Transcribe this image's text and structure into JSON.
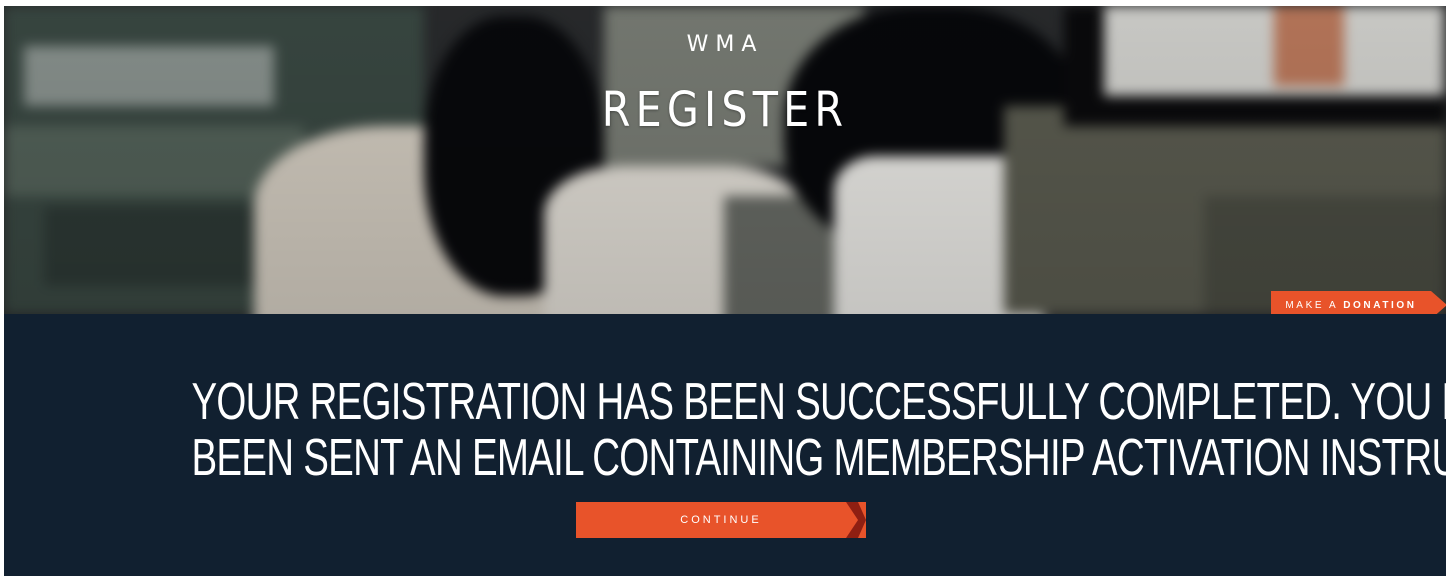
{
  "hero": {
    "brand": "WMA",
    "title": "REGISTER"
  },
  "donate": {
    "prefix": "MAKE A",
    "strong": "DONATION"
  },
  "message": {
    "line1": "Your registration has been successfully completed. You have just",
    "line2": "been sent an email containing membership activation instructions."
  },
  "actions": {
    "continue_label": "CONTINUE"
  },
  "colors": {
    "accent": "#e8532a",
    "band": "#112030"
  }
}
